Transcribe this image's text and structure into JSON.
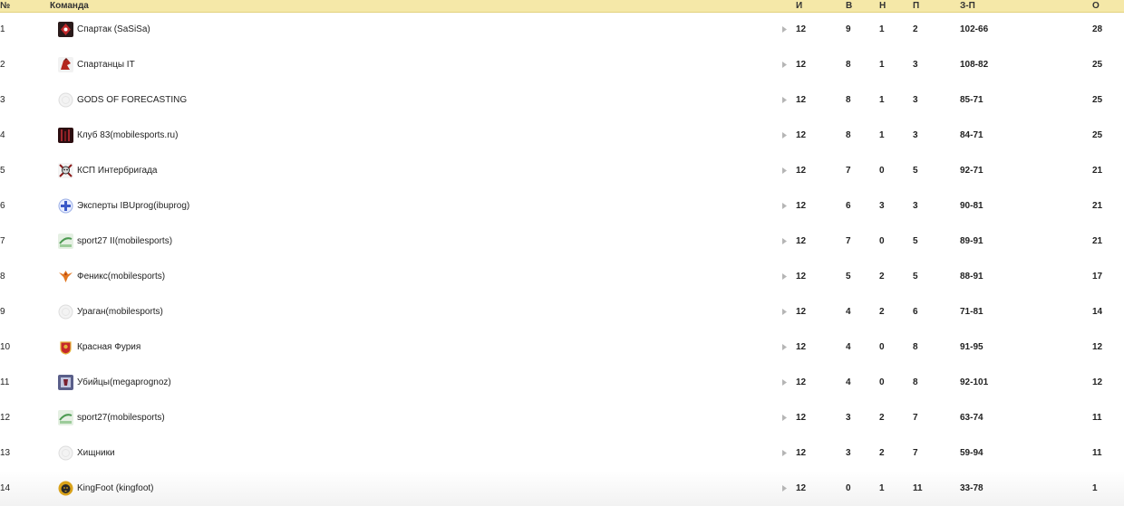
{
  "header": {
    "pos": "№",
    "team": "Команда",
    "played": "И",
    "won": "В",
    "drawn": "Н",
    "lost": "П",
    "goals": "З-П",
    "points": "О"
  },
  "rows": [
    {
      "pos": "1",
      "team": "Спартак (SaSiSa)",
      "played": "12",
      "won": "9",
      "drawn": "1",
      "lost": "2",
      "goals": "102-66",
      "points": "28",
      "logo": "spartak-logo"
    },
    {
      "pos": "2",
      "team": "Спартанцы IT",
      "played": "12",
      "won": "8",
      "drawn": "1",
      "lost": "3",
      "goals": "108-82",
      "points": "25",
      "logo": "spartan-logo"
    },
    {
      "pos": "3",
      "team": "GODS OF FORECASTING",
      "played": "12",
      "won": "8",
      "drawn": "1",
      "lost": "3",
      "goals": "85-71",
      "points": "25",
      "logo": "default-logo"
    },
    {
      "pos": "4",
      "team": "Клуб 83(mobilesports.ru)",
      "played": "12",
      "won": "8",
      "drawn": "1",
      "lost": "3",
      "goals": "84-71",
      "points": "25",
      "logo": "club83-logo"
    },
    {
      "pos": "5",
      "team": "КСП Интербригада",
      "played": "12",
      "won": "7",
      "drawn": "0",
      "lost": "5",
      "goals": "92-71",
      "points": "21",
      "logo": "skull-logo"
    },
    {
      "pos": "6",
      "team": "Эксперты IBUprog(ibuprog)",
      "played": "12",
      "won": "6",
      "drawn": "3",
      "lost": "3",
      "goals": "90-81",
      "points": "21",
      "logo": "cross-logo"
    },
    {
      "pos": "7",
      "team": "sport27 II(mobilesports)",
      "played": "12",
      "won": "7",
      "drawn": "0",
      "lost": "5",
      "goals": "89-91",
      "points": "21",
      "logo": "sport27-logo"
    },
    {
      "pos": "8",
      "team": "Феникс(mobilesports)",
      "played": "12",
      "won": "5",
      "drawn": "2",
      "lost": "5",
      "goals": "88-91",
      "points": "17",
      "logo": "phoenix-logo"
    },
    {
      "pos": "9",
      "team": "Ураган(mobilesports)",
      "played": "12",
      "won": "4",
      "drawn": "2",
      "lost": "6",
      "goals": "71-81",
      "points": "14",
      "logo": "default-logo"
    },
    {
      "pos": "10",
      "team": "Красная Фурия",
      "played": "12",
      "won": "4",
      "drawn": "0",
      "lost": "8",
      "goals": "91-95",
      "points": "12",
      "logo": "spain-crest-logo"
    },
    {
      "pos": "11",
      "team": "Убийцы(megaprognoz)",
      "played": "12",
      "won": "4",
      "drawn": "0",
      "lost": "8",
      "goals": "92-101",
      "points": "12",
      "logo": "killers-logo"
    },
    {
      "pos": "12",
      "team": "sport27(mobilesports)",
      "played": "12",
      "won": "3",
      "drawn": "2",
      "lost": "7",
      "goals": "63-74",
      "points": "11",
      "logo": "sport27-logo"
    },
    {
      "pos": "13",
      "team": "Хищники",
      "played": "12",
      "won": "3",
      "drawn": "2",
      "lost": "7",
      "goals": "59-94",
      "points": "11",
      "logo": "default-logo"
    },
    {
      "pos": "14",
      "team": "KingFoot (kingfoot)",
      "played": "12",
      "won": "0",
      "drawn": "1",
      "lost": "11",
      "goals": "33-78",
      "points": "1",
      "logo": "lion-logo"
    }
  ]
}
